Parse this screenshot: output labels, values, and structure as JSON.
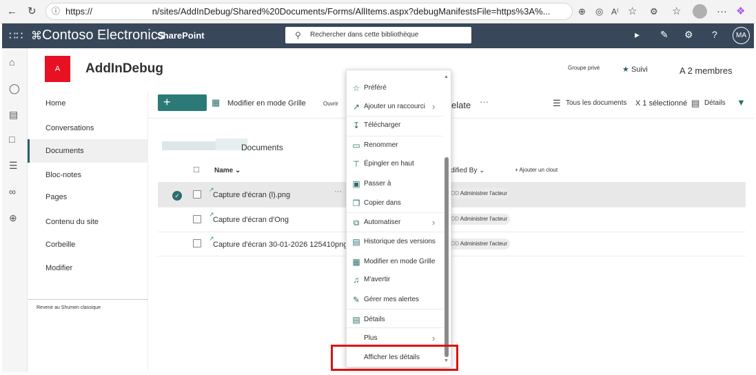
{
  "browser": {
    "url": "https://                         n/sites/AddInDebug/Shared%20Documents/Forms/AllItems.aspx?debugManifestsFile=https%3A%..."
  },
  "suite": {
    "brand": "Contoso Electronics",
    "app_name": "SharePoint",
    "search_placeholder": "Rechercher dans cette bibliothèque",
    "me_initials": "MA"
  },
  "site": {
    "logo_letter": "A",
    "title": "AddInDebug",
    "group_label": "Groupe privé",
    "follow_label": "Suivi",
    "members_label": "A 2 membres"
  },
  "nav": {
    "items": [
      "Home",
      "Conversations",
      "Documents",
      "Bloc-notes",
      "Pages",
      "Contenu du site",
      "Corbeille",
      "Modifier"
    ],
    "classic_link": "Revenir au Shumen classique"
  },
  "command_bar": {
    "new_label": "+",
    "edit_grid": "Modifier en mode Grille",
    "open": "Ouvrir",
    "template_partial": "elate",
    "ellipsis": "···",
    "all_docs": "Tous les documents",
    "selected": "X 1 sélectionné",
    "details": "Détails"
  },
  "library": {
    "title": "Documents",
    "col_name": "Name",
    "col_modified_by": "dified By",
    "add_column": "Ajouter un clout",
    "rows": [
      {
        "name": "Capture d'écran (l).png",
        "modified_by": "Administrer l'acteur",
        "od": "OD"
      },
      {
        "name": "Capture d'écran d'Ong",
        "modified_by": "Administrer l'acteur",
        "od": "OD"
      },
      {
        "name": "Capture d'écran 30-01-2026 125410png",
        "modified_by": "Administrer l'acteur",
        "od": "OD"
      }
    ],
    "row_more": "···"
  },
  "context_menu": {
    "items": [
      {
        "label": "Préféré",
        "icon": "star-icon"
      },
      {
        "label": "Ajouter un raccourci",
        "icon": "shortcut-icon",
        "submenu": true
      },
      {
        "label": "Télécharger",
        "icon": "download-icon"
      },
      {
        "label": "Renommer",
        "icon": "rename-icon"
      },
      {
        "label": "Épingler en haut",
        "icon": "pin-icon"
      },
      {
        "label": "Passer à",
        "icon": "move-icon"
      },
      {
        "label": "Copier dans",
        "icon": "copy-icon"
      },
      {
        "label": "Automatiser",
        "icon": "automate-icon",
        "submenu": true
      },
      {
        "label": "Historique des versions",
        "icon": "history-icon"
      },
      {
        "label": "Modifier en mode Grille",
        "icon": "grid-icon"
      },
      {
        "label": "M'avertir",
        "icon": "bell-icon"
      },
      {
        "label": "Gérer mes alertes",
        "icon": "alerts-icon"
      },
      {
        "label": "Détails",
        "icon": "details-icon"
      },
      {
        "label": "Plus",
        "icon": "",
        "submenu": true
      },
      {
        "label": "Afficher les détails",
        "icon": ""
      }
    ]
  }
}
